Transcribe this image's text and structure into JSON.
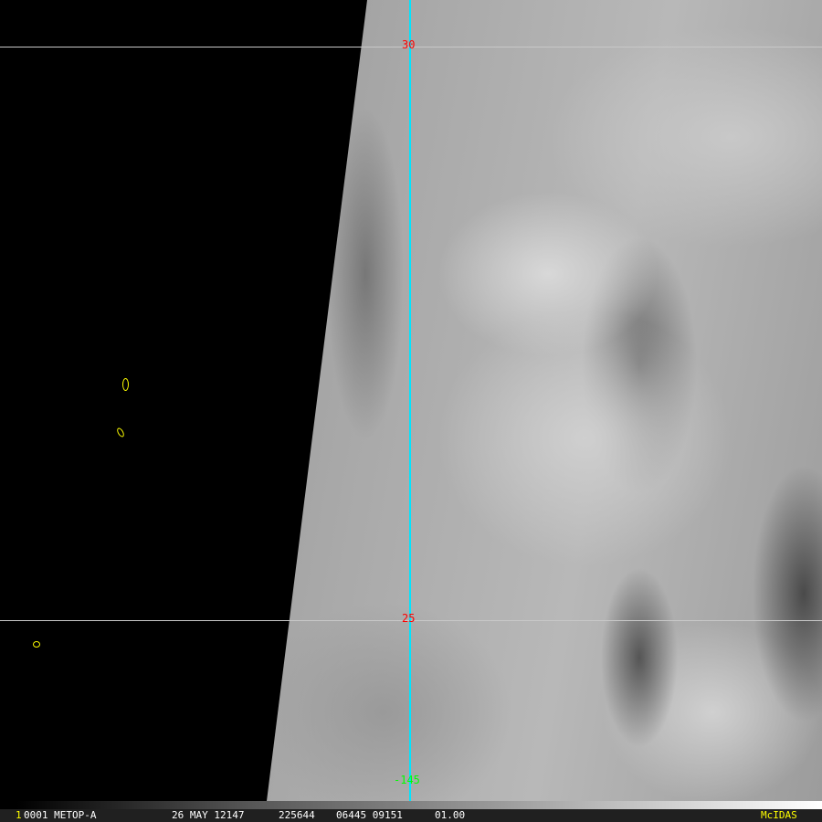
{
  "image": {
    "lat_labels": [
      {
        "value": "30"
      },
      {
        "value": "25"
      }
    ],
    "lon_label": {
      "value": "-145"
    },
    "colors": {
      "lat_label": "#ff0000",
      "lon_label": "#00ff00",
      "meridian": "#00e5ff",
      "coast": "#ffff00"
    }
  },
  "status_bar": {
    "frame_number": "1",
    "satellite": "0001 METOP-A",
    "date": "26 MAY 12147",
    "time": "225644",
    "line_elem": "06445 09151",
    "band": "01.00",
    "brand": "McIDAS"
  }
}
